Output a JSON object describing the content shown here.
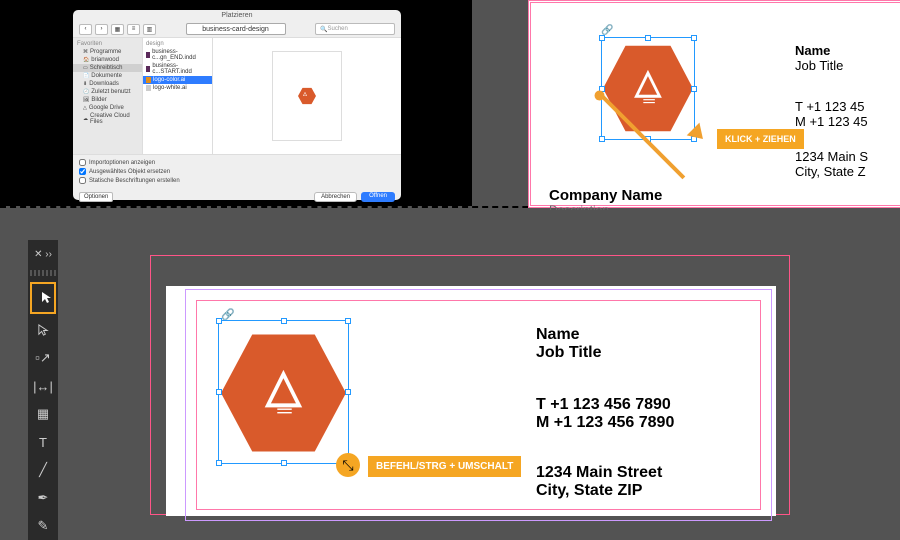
{
  "dialog": {
    "title": "Platzieren",
    "dropdown": "business-card-design",
    "search_placeholder": "Suchen",
    "sidebar_header": "Favoriten",
    "sidebar": [
      "Programme",
      "brianwood",
      "Schreibtisch",
      "Dokumente",
      "Downloads",
      "Zuletzt benutzt",
      "Bilder",
      "Google Drive",
      "Creative Cloud Files"
    ],
    "sidebar_selected": 2,
    "col_header": "design",
    "files": [
      {
        "name": "business-c...gn_END.indd",
        "type": "indd"
      },
      {
        "name": "business-c...START.indd",
        "type": "indd"
      },
      {
        "name": "logo-color.ai",
        "type": "ai"
      },
      {
        "name": "logo-white.ai",
        "type": "doc"
      }
    ],
    "file_selected": 2,
    "checks": [
      {
        "label": "Importoptionen anzeigen",
        "checked": false
      },
      {
        "label": "Ausgewähltes Objekt ersetzen",
        "checked": true
      },
      {
        "label": "Statische Beschriftungen erstellen",
        "checked": false
      }
    ],
    "options": "Optionen",
    "cancel": "Abbrechen",
    "open": "Öffnen"
  },
  "card_top": {
    "name": "Name",
    "job": "Job Title",
    "t": "T  +1 123 45",
    "m": "M +1 123 45",
    "addr1": "1234 Main S",
    "addr2": "City, State Z",
    "company": "Company Name",
    "desc": "Description"
  },
  "badges": {
    "drag": "KLICK + ZIEHEN",
    "mod": "BEFEHL/STRG + UMSCHALT"
  },
  "card_bot": {
    "name": "Name",
    "job": "Job Title",
    "t": "T  +1 123 456 7890",
    "m": "M +1 123 456 7890",
    "addr1": "1234 Main Street",
    "addr2": "City, State ZIP"
  }
}
